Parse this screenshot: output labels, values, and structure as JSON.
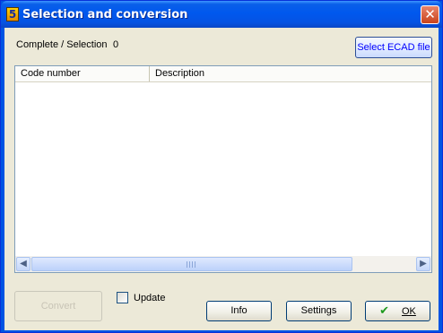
{
  "window": {
    "title": "Selection and conversion",
    "icon_glyph": "5",
    "close_glyph": "✕"
  },
  "status": {
    "label": "Complete / Selection",
    "count": "0"
  },
  "buttons": {
    "select_ecad": "Select ECAD file",
    "convert": "Convert",
    "info": "Info",
    "settings": "Settings",
    "ok": "OK"
  },
  "update": {
    "label": "Update",
    "checked": false
  },
  "grid": {
    "columns": [
      "Code number",
      "Description"
    ],
    "rows": []
  },
  "icons": {
    "app": "app-icon",
    "close": "close-icon",
    "ok": "check-icon",
    "scroll_left": "scroll-left-arrow",
    "scroll_right": "scroll-right-arrow"
  },
  "colors": {
    "titlebar": "#0054e3",
    "dialog_background": "#ece9d8",
    "ecad_button_text": "#0000ff",
    "ok_check": "#1e9a1e"
  }
}
